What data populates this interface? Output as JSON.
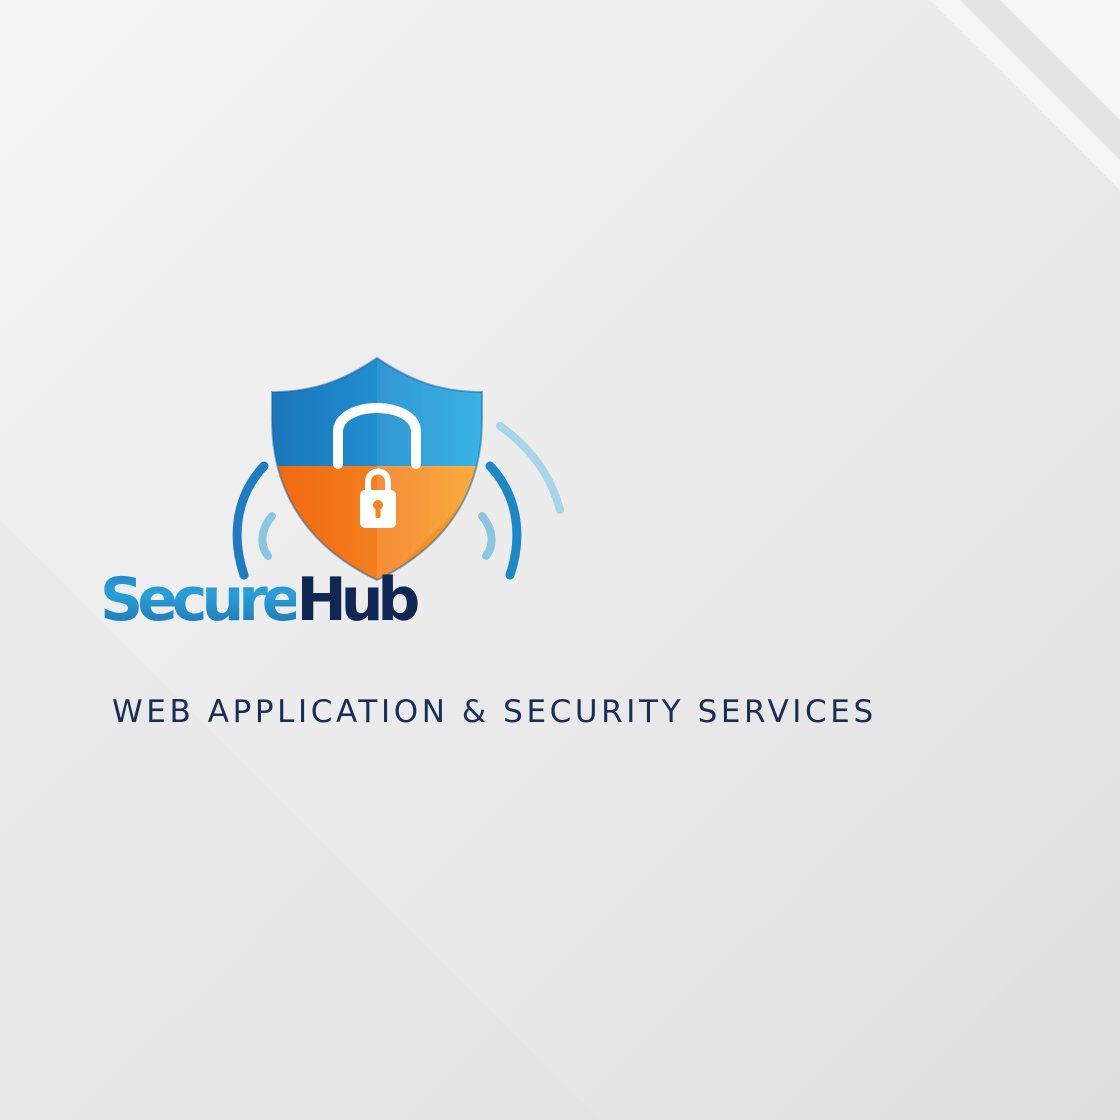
{
  "logo": {
    "brand_part_1": "Secure",
    "brand_part_2": "Hub",
    "tagline": "WEB APPLICATION & SECURITY SERVICES",
    "emblem": {
      "icon": "shield-lock-icon",
      "inner_icon": "padlock-icon",
      "waves_icon": "signal-waves-icon"
    }
  },
  "colors": {
    "navy": "#0f2752",
    "blue": "#1e7fc0",
    "sky_blue": "#2aa0d8",
    "orange": "#f5821f",
    "background": "#ececec"
  }
}
